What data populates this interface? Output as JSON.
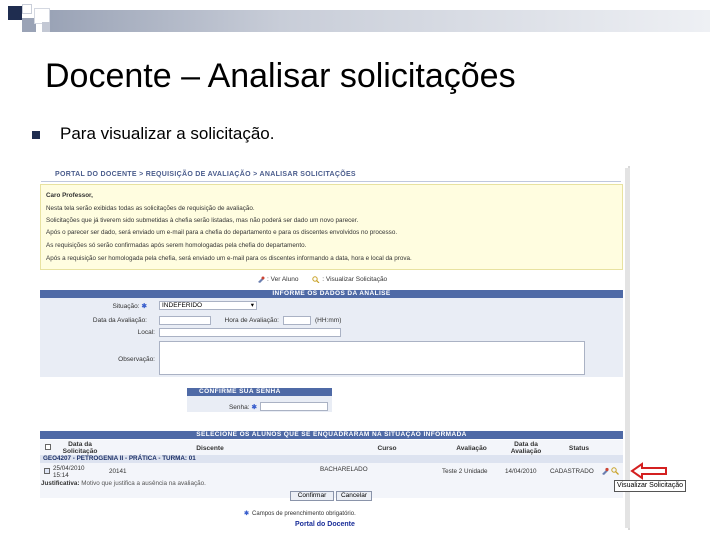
{
  "slide": {
    "title": "Docente – Analisar solicitações",
    "bullet": "Para visualizar a solicitação."
  },
  "screen": {
    "breadcrumb": "Portal do Docente > Requisição de Avaliação > Analisar Solicitações",
    "notice": {
      "lines": [
        "Caro Professor,",
        "Nesta tela serão exibidas todas as solicitações de requisição de avaliação.",
        "Solicitações que já tiverem sido submetidas à chefia serão listadas, mas não poderá ser dado um novo parecer.",
        "Após o parecer ser dado, será enviado um e-mail para a chefia do departamento e para os discentes envolvidos no processo.",
        "As requisições só serão confirmadas após serem homologadas pela chefia do departamento.",
        "Após a requisição ser homologada pela chefia, será enviado um e-mail para os discentes informando a data, hora e local da prova."
      ]
    },
    "legend": {
      "ver_aluno": ": Ver Aluno",
      "visualizar": ": Visualizar Solicitação"
    },
    "form": {
      "header": "Informe os Dados da Análise",
      "situacao_label": "Situação:",
      "situacao_value": "INDEFERIDO",
      "data_label": "Data da Avaliação:",
      "hora_label": "Hora de Avaliação:",
      "hora_unit": "(HH:mm)",
      "local_label": "Local:",
      "obs_label": "Observação:"
    },
    "password": {
      "header": "Confirme sua Senha",
      "label": "Senha:"
    },
    "table": {
      "header": "Selecione os Alunos que se Enquadraram na Situação Informada",
      "columns": [
        "Data da Solicitação",
        "Discente",
        "Curso",
        "Avaliação",
        "Data da Avaliação",
        "Status"
      ],
      "group": "GEO4207 - PETROGENIA II - PRÁTICA - Turma: 01",
      "row": {
        "data": "25/04/2010 15:14",
        "discente": "20141",
        "curso": "BACHARELADO",
        "avaliacao": "Teste 2 Unidade",
        "data_avaliacao": "14/04/2010",
        "status": "CADASTRADO"
      },
      "justificativa_label": "Justificativa:",
      "justificativa": "Motivo que justifica a ausência na avaliação."
    },
    "buttons": {
      "confirmar": "Confirmar",
      "cancelar": "Cancelar"
    },
    "required_note": "Campos de preenchimento obrigatório.",
    "footer_link": "Portal do Docente",
    "required_mark": "✱"
  },
  "callout": "Visualizar Solicitação",
  "colors": {
    "section_header": "#4f6aa6",
    "notice_bg": "#fffde0",
    "arrow": "#d42020",
    "bullet": "#1f2d50"
  }
}
